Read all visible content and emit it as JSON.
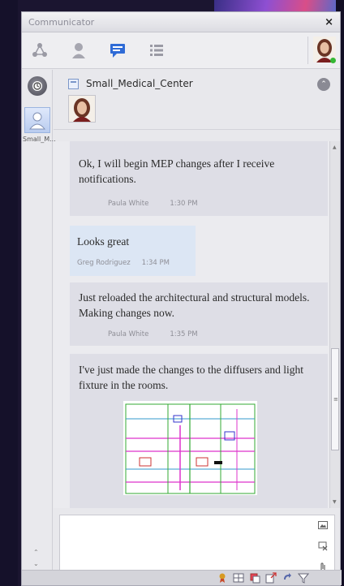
{
  "window": {
    "title": "Communicator",
    "close_label": "×"
  },
  "toolbar": {
    "tabs": [
      {
        "icon": "network-icon"
      },
      {
        "icon": "contacts-icon"
      },
      {
        "icon": "chat-icon",
        "active": true
      },
      {
        "icon": "list-icon"
      }
    ],
    "status_color": "#35b835"
  },
  "sidebar": {
    "history_icon": "history-icon",
    "conversation_tab_label": "Small_M..."
  },
  "conversation": {
    "name": "Small_Medical_Center",
    "collapse_label": "⌃"
  },
  "messages": [
    {
      "text": "Ok, I will begin MEP changes after I receive notifications.",
      "author": "Paula White",
      "time": "1:30 PM",
      "style": "gray"
    },
    {
      "text": "Looks great",
      "author": "Greg Rodriguez",
      "time": "1:34 PM",
      "style": "blue"
    },
    {
      "text": "Just reloaded the architectural and structural models.  Making changes now.",
      "author": "Paula White",
      "time": "1:35 PM",
      "style": "gray"
    },
    {
      "text": "I've just made the changes to the diffusers and light fixture in the rooms.",
      "author": "",
      "time": "",
      "style": "gray",
      "has_image": true
    }
  ],
  "composer": {
    "value": "",
    "tools": [
      "image-icon",
      "screenshot-icon",
      "attach-icon"
    ]
  },
  "colors": {
    "accent": "#2f6bd6",
    "panel": "#e8e8ec"
  }
}
